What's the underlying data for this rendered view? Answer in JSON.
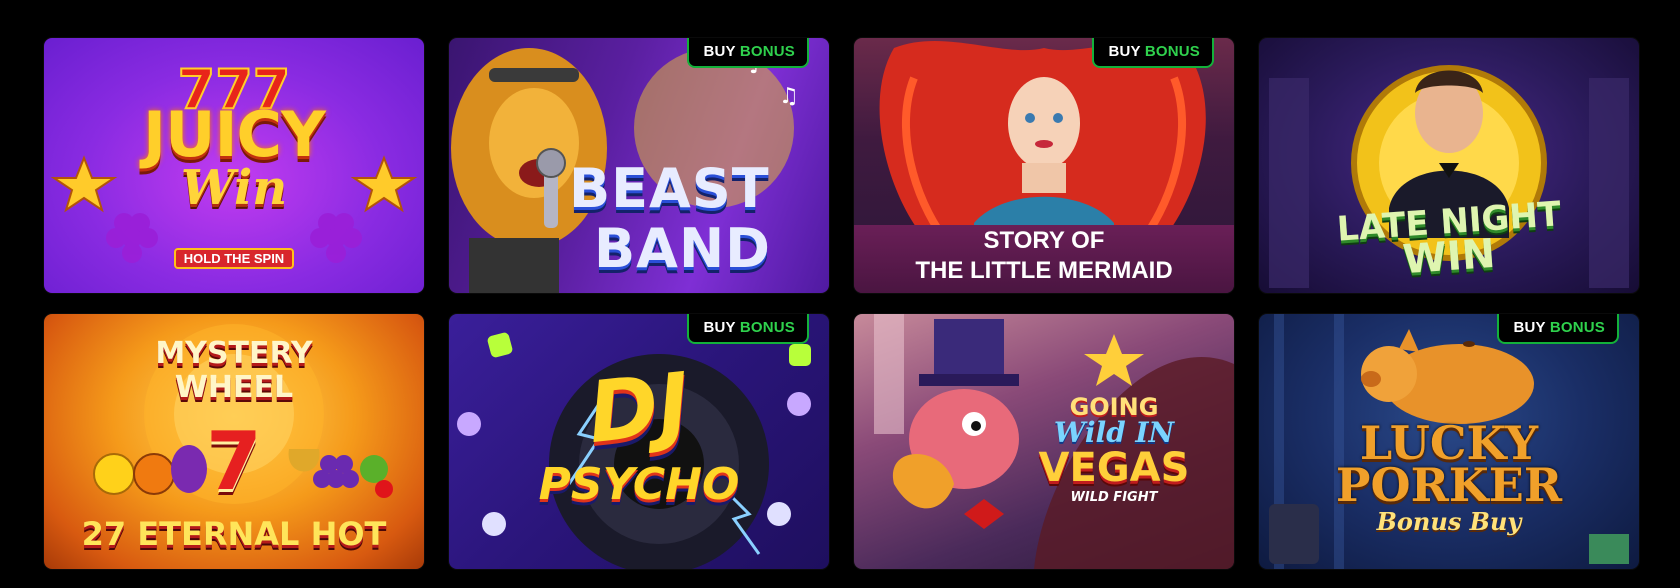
{
  "badge": {
    "word1": "BUY",
    "word2": "BONUS"
  },
  "games": [
    {
      "name": "Juicy Win",
      "title_line1": "JUICY",
      "title_line2": "Win",
      "tagline": "HOLD THE SPIN",
      "buy_bonus": false
    },
    {
      "name": "Beast Band",
      "title_line1": "BEAST",
      "title_line2": "BAND",
      "buy_bonus": true
    },
    {
      "name": "Story of the Little Mermaid",
      "title_line1": "STORY OF",
      "title_line2": "THE LITTLE MERMAID",
      "buy_bonus": true
    },
    {
      "name": "Late Night Win",
      "title_line1": "LATE NIGHT",
      "title_line2": "WIN",
      "buy_bonus": false
    },
    {
      "name": "Mystery Wheel 27 Eternal Hot",
      "title_line1": "MYSTERY",
      "title_line2": "WHEEL",
      "symbol": "7",
      "title_line3": "27 ETERNAL HOT",
      "buy_bonus": false
    },
    {
      "name": "DJ Psycho",
      "title_line1": "DJ",
      "title_line2": "PSYCHO",
      "buy_bonus": true
    },
    {
      "name": "Going Wild in Vegas",
      "title_line1": "GOING",
      "title_line2": "Wild IN",
      "title_line3": "VEGAS",
      "tagline": "WILD FIGHT",
      "buy_bonus": false
    },
    {
      "name": "Lucky Porker Bonus Buy",
      "title_line1": "LUCKY",
      "title_line2": "PORKER",
      "title_line3": "Bonus Buy",
      "buy_bonus": true
    }
  ],
  "colors": {
    "background": "#000000",
    "badge_green": "#2fd14d",
    "badge_border": "#13b13a"
  }
}
